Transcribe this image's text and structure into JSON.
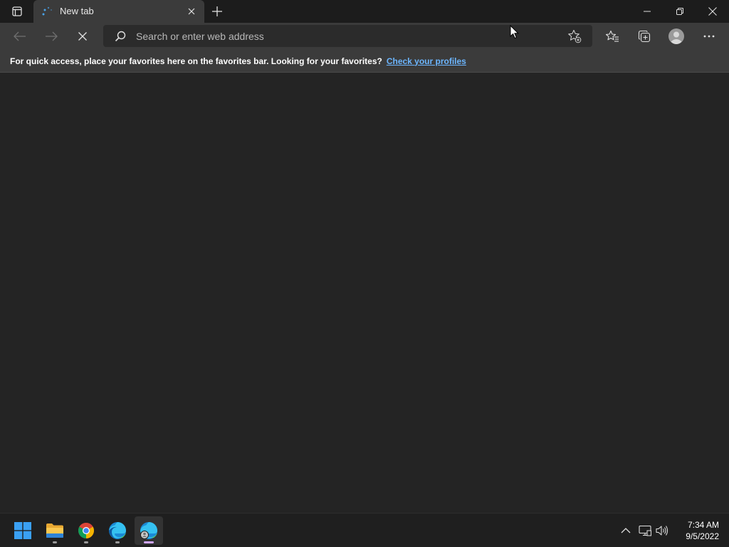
{
  "browser": {
    "tab": {
      "title": "New tab"
    },
    "address_bar": {
      "placeholder": "Search or enter web address",
      "value": ""
    },
    "favorites_bar": {
      "message": "For quick access, place your favorites here on the favorites bar. Looking for your favorites?",
      "link_label": "Check your profiles"
    },
    "icons": {
      "tab_actions": "tab-actions-icon",
      "tab_close": "close-icon",
      "new_tab": "plus-icon",
      "minimize": "minimize-icon",
      "restore": "restore-icon",
      "close_window": "close-icon",
      "back": "arrow-left-icon",
      "forward": "arrow-right-icon",
      "stop": "stop-icon",
      "search": "search-icon",
      "add_favorite": "star-add-icon",
      "favorites": "favorites-icon",
      "collections": "collections-icon",
      "profile": "profile-icon",
      "more": "more-icon"
    },
    "colors": {
      "link": "#6cb6ff",
      "toolbar_bg": "#3b3b3b",
      "content_bg": "#242424"
    }
  },
  "taskbar": {
    "apps": [
      {
        "name": "start",
        "icon": "windows-start-icon"
      },
      {
        "name": "file-explorer",
        "icon": "folder-icon"
      },
      {
        "name": "chrome",
        "icon": "chrome-icon"
      },
      {
        "name": "edge",
        "icon": "edge-icon"
      },
      {
        "name": "edge-profile",
        "icon": "edge-profile-icon",
        "active": true
      }
    ],
    "tray": {
      "icons": [
        "chevron-up-icon",
        "network-icon",
        "volume-icon"
      ],
      "time": "7:34 AM",
      "date": "9/5/2022"
    }
  }
}
